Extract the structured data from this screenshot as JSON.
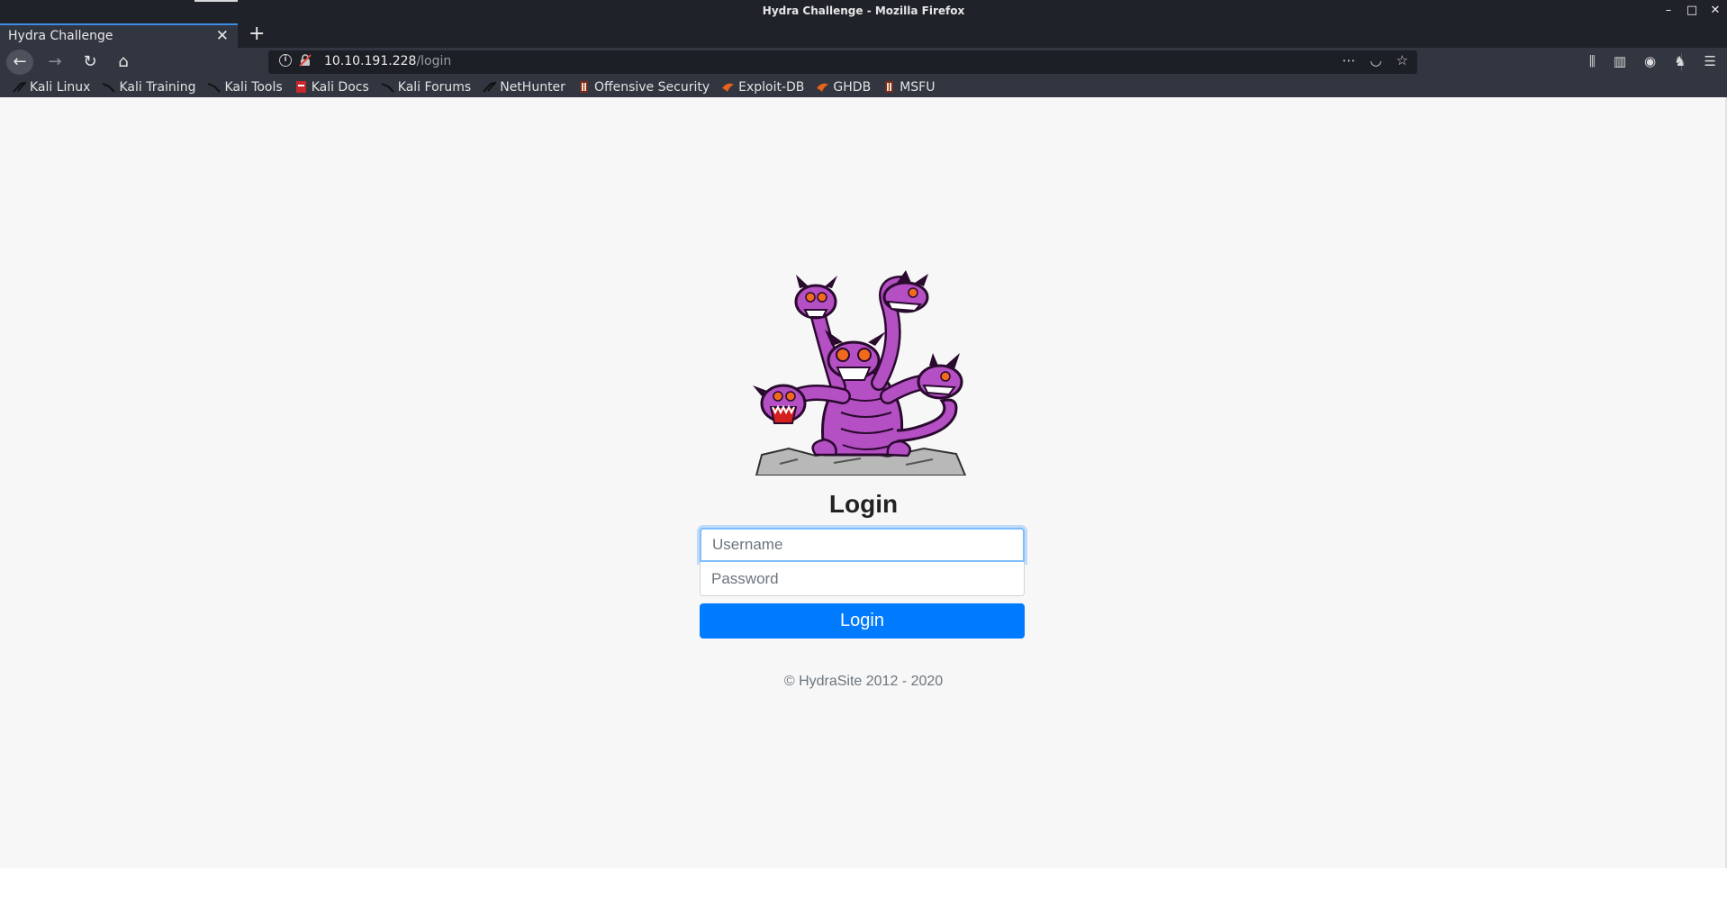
{
  "window": {
    "title": "Hydra Challenge - Mozilla Firefox",
    "controls": {
      "minimize": "–",
      "maximize": "□",
      "close": "✕"
    }
  },
  "tabs": [
    {
      "label": "Hydra Challenge",
      "close": "✕",
      "active": true
    }
  ],
  "new_tab": "+",
  "navbar": {
    "back_icon": "←",
    "forward_icon": "→",
    "reload_icon": "↻",
    "home_icon": "⌂",
    "url_host": "10.10.191.228",
    "url_path": "/login",
    "url_actions": {
      "more": "⋯",
      "pocket": "◡",
      "star": "☆"
    },
    "tools": {
      "library": "⫼",
      "sidebar": "▥",
      "account": "◉",
      "extension": "♞",
      "menu": "☰"
    }
  },
  "bookmarks": [
    {
      "label": "Kali Linux",
      "icon": "kali-dragon-icon"
    },
    {
      "label": "Kali Training",
      "icon": "kali-dragon-icon"
    },
    {
      "label": "Kali Tools",
      "icon": "kali-dragon-icon"
    },
    {
      "label": "Kali Docs",
      "icon": "kali-docs-icon"
    },
    {
      "label": "Kali Forums",
      "icon": "kali-dragon-icon"
    },
    {
      "label": "NetHunter",
      "icon": "kali-dragon-icon"
    },
    {
      "label": "Offensive Security",
      "icon": "offsec-icon"
    },
    {
      "label": "Exploit-DB",
      "icon": "exploit-db-icon"
    },
    {
      "label": "GHDB",
      "icon": "exploit-db-icon"
    },
    {
      "label": "MSFU",
      "icon": "offsec-icon"
    }
  ],
  "page": {
    "heading": "Login",
    "username_placeholder": "Username",
    "password_placeholder": "Password",
    "login_button": "Login",
    "footer": "© HydraSite 2012 - 2020"
  },
  "colors": {
    "primary": "#007bff",
    "chrome_dark": "#1f2228",
    "chrome": "#323640",
    "page_bg": "#f7f7f7",
    "hydra_purple": "#b44fc4"
  }
}
